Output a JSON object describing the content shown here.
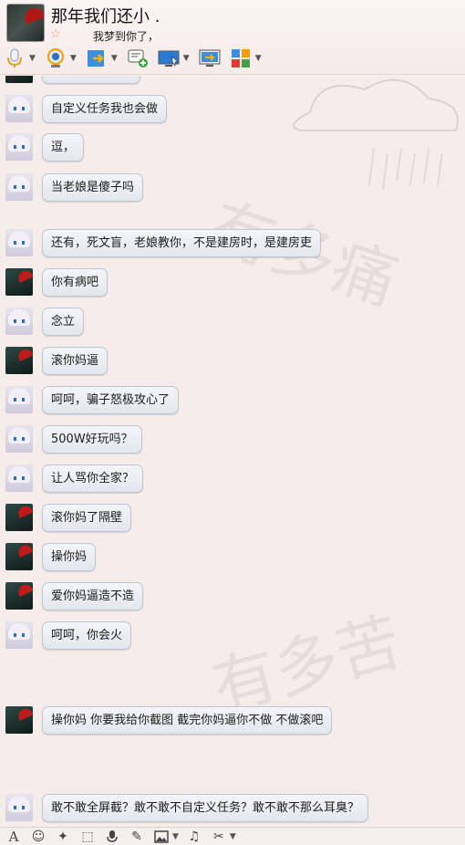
{
  "header": {
    "contact_name": "那年我们还小 .",
    "signature": "我梦到你了，",
    "toolbar": [
      {
        "icon": "microphone-icon",
        "has_dropdown": true
      },
      {
        "icon": "webcam-icon",
        "has_dropdown": true
      },
      {
        "icon": "file-transfer-icon",
        "has_dropdown": true
      },
      {
        "icon": "new-message-icon",
        "has_dropdown": false
      },
      {
        "icon": "remote-assist-icon",
        "has_dropdown": true
      },
      {
        "icon": "screen-share-icon",
        "has_dropdown": false
      },
      {
        "icon": "apps-icon",
        "has_dropdown": true
      }
    ]
  },
  "messages": [
    {
      "sender": "anime",
      "text": "自定义任务我也会做"
    },
    {
      "sender": "anime",
      "text": "逗，"
    },
    {
      "sender": "anime",
      "text": "当老娘是傻子吗"
    },
    {
      "sender": "anime",
      "text": "还有，死文盲，老娘教你，不是建房时，是建房吏"
    },
    {
      "sender": "red",
      "text": "你有病吧"
    },
    {
      "sender": "anime",
      "text": "念立"
    },
    {
      "sender": "red",
      "text": "滚你妈逼"
    },
    {
      "sender": "anime",
      "text": "呵呵，骗子怒极攻心了"
    },
    {
      "sender": "anime",
      "text": "500W好玩吗？"
    },
    {
      "sender": "anime",
      "text": "让人骂你全家？"
    },
    {
      "sender": "red",
      "text": "滚你妈了隔壁"
    },
    {
      "sender": "red",
      "text": "操你妈"
    },
    {
      "sender": "red",
      "text": "爱你妈逼造不造"
    },
    {
      "sender": "anime",
      "text": "呵呵，你会火"
    },
    {
      "sender": "red",
      "text": "操你妈 你要我给你截图 截完你妈逼你不做 不做滚吧"
    },
    {
      "sender": "anime",
      "text": "敢不敢全屏截？敢不敢不自定义任务？敢不敢不那么耳臭？"
    }
  ],
  "watermarks": [
    "有多痛",
    "有多苦"
  ],
  "input_toolbar": [
    "font-icon",
    "emoji-icon",
    "magic-icon",
    "screenshot-icon",
    "voice-icon",
    "edit-icon",
    "image-icon",
    "music-icon",
    "scissors-icon"
  ],
  "colors": {
    "background": "#f6ecea",
    "bubble_border": "#bcc5d0",
    "star": "#f0b400"
  }
}
